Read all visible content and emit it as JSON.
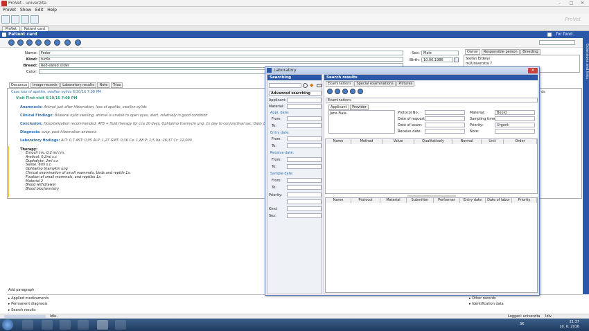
{
  "window": {
    "title": "ProVet - univerzita"
  },
  "menu": [
    "ProVet",
    "Show",
    "Edit",
    "Help"
  ],
  "branding": "ProVet",
  "tabs": [
    "ProVet",
    "Patient card"
  ],
  "header": {
    "title": "Patient card",
    "for_food": "for food"
  },
  "sidebar": {
    "label": "Extensions and links"
  },
  "patient": {
    "name_label": "Name:",
    "name": "Fedor",
    "kind_label": "Kind:",
    "kind": "turtle",
    "breed_label": "Breed:",
    "breed": "Red-eared slider",
    "color_label": "Color:",
    "color": "",
    "sex_label": "Sex:",
    "sex": "Male",
    "birth_label": "Birth:",
    "birth": "10.06.1986"
  },
  "owner_tabs": [
    "Owner",
    "Responsible person",
    "Breeding"
  ],
  "owner": {
    "name": "Stefan Erdelyi",
    "address": "m2Univerzita 7"
  },
  "record_tabs": [
    "Decursus",
    "Image records",
    "Laboratory results",
    "Note",
    "Trias"
  ],
  "record": {
    "case": "Case loss of apetite, swollen eylids 6/10/16 7:08 PM",
    "visit": "Visit First visit 6/10/16 7:08 PM",
    "anamnesis_label": "Anamnesis:",
    "anamnesis": "Animal just after hibernation, loss of apetite, swollen eylids",
    "clinical_label": "Clinical Findings:",
    "clinical": "Bilateral eylid swelling, animal is unable to open eyes,  alert, relatively in good condition",
    "conclusion_label": "Conclusion:",
    "conclusion": "Hospitalization recommended, ATB + fluid therapy for cca 10 days, Ophtalmo thamycin ung. 1x day to conjunctival sac, Daily bathing for 2-3 hours-",
    "diagnosis_label": "Diagnosis:",
    "diagnosis": "susp. post hibernation anorexia",
    "lab_label": "Laboratory findings:",
    "lab": "ALT: 0,7 AST: 0,05 ALP: 1,27 GMT: 0,36 Ca: 1,88 P: 1,5 Ua: 26,37 Cr: 12,000",
    "therapy_label": "Therapy:",
    "therapy": [
      "Enrovil i.m. 0,2 ml i.m.",
      "Aretical: 0,2ml s.c",
      "Duphalyte: 2ml s.c",
      "Saline: 6ml s.c",
      "Ophtalmo thamykin ung",
      "Clinical examination of small  mammals, birds and reptile 1x.",
      "Fixation of small mammals,  and reptiles 1x.",
      "Material 2",
      "Blood withdrawal",
      "Blood biochemistry"
    ],
    "add_paragraph": "Add paragraph",
    "right_trunc": "ds"
  },
  "bottom": {
    "left": [
      "Applied medicaments",
      "Permanent diagnosis",
      "Search results"
    ],
    "right": [
      "Other records",
      "Identification data"
    ]
  },
  "status": {
    "idle": "Idle..",
    "logged": "Logged: univerzita",
    "lang": "Idiv"
  },
  "taskbar": {
    "lang": "SK",
    "time": "21:37",
    "date": "10. 6. 2016"
  },
  "lab": {
    "title": "Laboratory",
    "search_head": "Searching",
    "adv": "Advanced searching",
    "applicant": "Applicant:",
    "material": "Material:",
    "appl_date": "Appl. date:",
    "entry_date": "Entry date:",
    "receive_date": "Receive date:",
    "sample_date": "Sample date:",
    "from": "From:",
    "to": "To:",
    "priority": "Priority:",
    "kind": "Kind:",
    "sex": "Sex:",
    "results_head": "Search results",
    "tabs": [
      "Examinations",
      "Special examinations",
      "Pictures"
    ],
    "exam_select": "Examinations",
    "sub_tabs": [
      "Applicant",
      "Provider"
    ],
    "applicant_name": "Jana Fiala",
    "protocol_no": "Protocol No.:",
    "date_request": "Date of request:",
    "date_exam": "Date of exam:",
    "receive": "Receive date:",
    "material2": "Material:",
    "material_val": "Boold",
    "sampling": "Sampling time:",
    "priority2": "Priority:",
    "priority_val": "Urgent",
    "note": "Note:",
    "grid1": [
      "Name",
      "Method",
      "Value",
      "Qualitatively",
      "Normal",
      "Unit",
      "Order"
    ],
    "grid2": [
      "Name",
      "Protocol",
      "Material",
      "Submitter",
      "Performer",
      "Entry date",
      "Date of labor",
      "Priority"
    ]
  },
  "colors": {
    "accent": "#2a58a6",
    "link": "#2f6fb0"
  }
}
